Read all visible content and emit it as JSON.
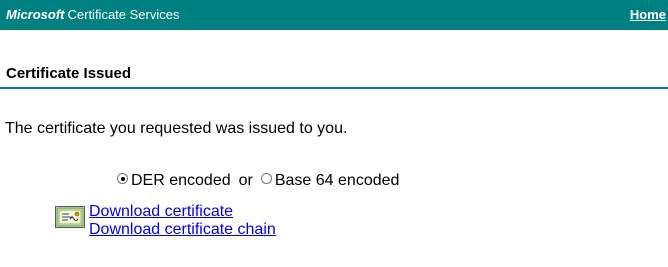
{
  "header": {
    "brand_bold": "Microsoft",
    "brand_rest": "Certificate Services",
    "home_link": "Home"
  },
  "main": {
    "heading": "Certificate Issued",
    "intro": "The certificate you requested was issued to you.",
    "encoding": {
      "selected": "DER encoded",
      "der_label": "DER encoded",
      "or_label": "or",
      "base64_label": "Base 64 encoded"
    },
    "download_certificate": "Download certificate",
    "download_chain": "Download certificate chain",
    "certificate_icon": "certificate-icon"
  },
  "colors": {
    "header_bg": "#008080",
    "header_text": "#ffffff",
    "rule": "#008080",
    "link": "#0000ee"
  }
}
